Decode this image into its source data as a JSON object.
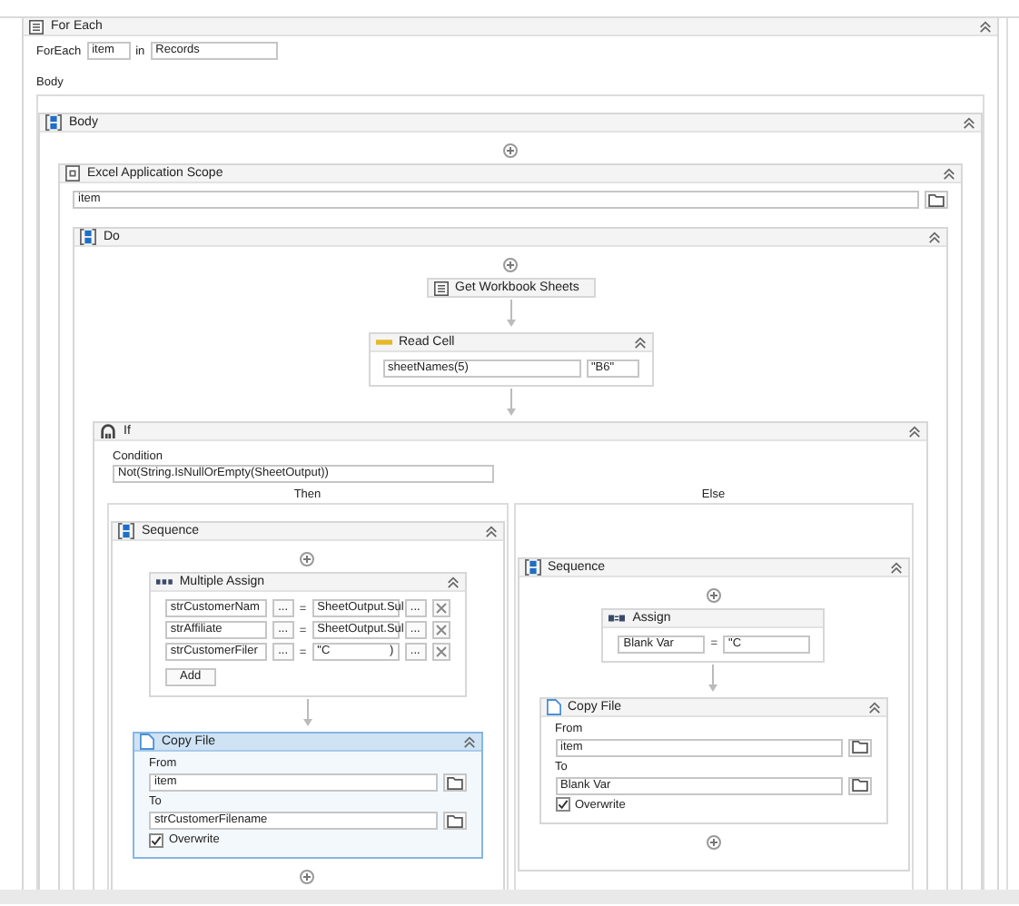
{
  "designer": {
    "for_each": {
      "title": "For Each",
      "foreach_label": "ForEach",
      "item": "item",
      "in_label": "in",
      "values": "Records",
      "body_label": "Body",
      "body": {
        "kind": "sequence",
        "title": "Body",
        "children": [
          {
            "kind": "drop"
          },
          {
            "kind": "scope",
            "title": "Excel Application Scope",
            "path": "item",
            "body": {
              "kind": "sequence",
              "title": "Do",
              "children": [
                {
                  "kind": "drop"
                },
                {
                  "kind": "collapsed",
                  "title": "Get Workbook Sheets"
                },
                {
                  "kind": "read_cell",
                  "title": "Read Cell",
                  "sheet": "sheetNames(5)",
                  "cell": "\"B6\""
                },
                {
                  "kind": "if",
                  "title": "If",
                  "condition_label": "Condition",
                  "condition": "Not(String.IsNullOrEmpty(SheetOutput))",
                  "then_label": "Then",
                  "else_label": "Else",
                  "then": {
                    "kind": "sequence",
                    "title": "Sequence",
                    "children": [
                      {
                        "kind": "drop"
                      },
                      {
                        "kind": "multiple_assign",
                        "title": "Multiple Assign",
                        "add": "Add",
                        "rows": [
                          {
                            "to": "strCustomerNam",
                            "to_more": "...",
                            "op": "=",
                            "value": "SheetOutput.Sul",
                            "value_end": "",
                            "value_more": "..."
                          },
                          {
                            "to": "strAffiliate",
                            "to_more": "...",
                            "op": "=",
                            "value": "SheetOutput.Sul",
                            "value_end": "",
                            "value_more": "..."
                          },
                          {
                            "to": "strCustomerFiler",
                            "to_more": "...",
                            "op": "=",
                            "value": "\"C",
                            "value_end": ")",
                            "value_more": "..."
                          }
                        ]
                      },
                      {
                        "kind": "copy_file",
                        "title": "Copy File",
                        "selected": true,
                        "from_label": "From",
                        "from": "item",
                        "to_label": "To",
                        "to": "strCustomerFilename",
                        "overwrite": {
                          "label": "Overwrite",
                          "checked": true
                        }
                      },
                      {
                        "kind": "drop"
                      }
                    ]
                  },
                  "else": {
                    "kind": "sequence",
                    "title": "Sequence",
                    "children": [
                      {
                        "kind": "drop"
                      },
                      {
                        "kind": "assign",
                        "title": "Assign",
                        "to": "Blank Var",
                        "op": "=",
                        "value": "\"C"
                      },
                      {
                        "kind": "copy_file",
                        "title": "Copy File",
                        "selected": false,
                        "from_label": "From",
                        "from": "item",
                        "to_label": "To",
                        "to": "Blank Var",
                        "overwrite": {
                          "label": "Overwrite",
                          "checked": true
                        }
                      },
                      {
                        "kind": "drop"
                      }
                    ]
                  }
                }
              ]
            }
          }
        ]
      }
    }
  }
}
